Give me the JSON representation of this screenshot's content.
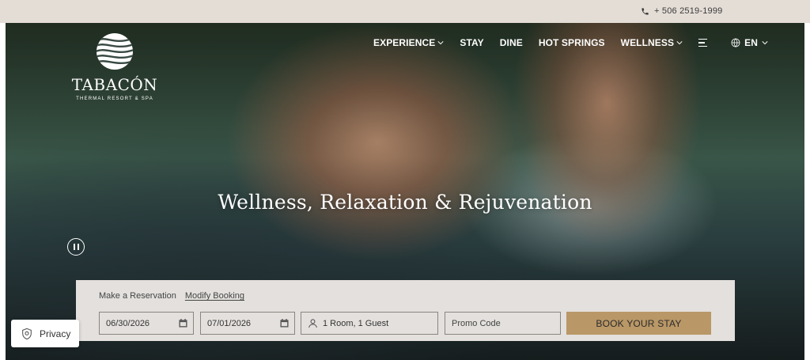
{
  "topbar": {
    "phone": "+ 506 2519-1999",
    "phone_icon": "phone-icon"
  },
  "brand": {
    "name": "TABACÓN",
    "tagline": "THERMAL RESORT & SPA"
  },
  "nav": {
    "items": [
      {
        "label": "EXPERIENCE",
        "has_dropdown": true
      },
      {
        "label": "STAY",
        "has_dropdown": false
      },
      {
        "label": "DINE",
        "has_dropdown": false
      },
      {
        "label": "HOT SPRINGS",
        "has_dropdown": false
      },
      {
        "label": "WELLNESS",
        "has_dropdown": true
      }
    ],
    "language": "EN"
  },
  "hero": {
    "headline": "Wellness, Relaxation & Rejuvenation"
  },
  "booking": {
    "tab_reservation": "Make a Reservation",
    "tab_modify": "Modify Booking",
    "checkin": "06/30/2026",
    "checkout": "07/01/2026",
    "guests": "1 Room, 1 Guest",
    "promo_placeholder": "Promo Code",
    "book_label": "BOOK YOUR STAY"
  },
  "privacy": {
    "label": "Privacy"
  },
  "colors": {
    "topbar": "#e4ddd6",
    "booking_bg": "#e3e0dd",
    "accent": "#b99766"
  }
}
